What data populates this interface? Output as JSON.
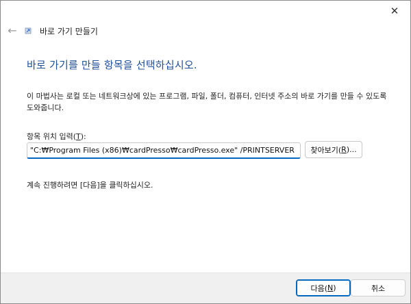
{
  "window": {
    "close_glyph": "✕",
    "back_glyph": "←",
    "wizard_title": "바로 가기 만들기"
  },
  "main": {
    "instruction": "바로 가기를 만들 항목을 선택하십시오.",
    "description": "이 마법사는 로컬 또는 네트워크상에 있는 프로그램, 파일, 폴더, 컴퓨터, 인터넷 주소의 바로 가기를 만들 수 있도록 도와줍니다.",
    "field_label_prefix": "항목 위치 입력(",
    "field_label_mnemonic": "T",
    "field_label_suffix": "):",
    "location_value": "\"C:₩Program Files (x86)₩cardPresso₩cardPresso.exe\" /PRINTSERVER",
    "browse_prefix": "찾아보기(",
    "browse_mnemonic": "R",
    "browse_suffix": ")...",
    "hint": "계속 진행하려면 [다음]을 클릭하십시오."
  },
  "footer": {
    "next_prefix": "다음(",
    "next_mnemonic": "N",
    "next_suffix": ")",
    "cancel_label": "취소"
  },
  "colors": {
    "instruction": "#1f4e99",
    "accent": "#0067c0",
    "footer_bg": "#f0f0f0"
  },
  "icons": {
    "back": "back-arrow-icon",
    "close": "close-icon",
    "wizard": "shortcut-wizard-icon"
  }
}
